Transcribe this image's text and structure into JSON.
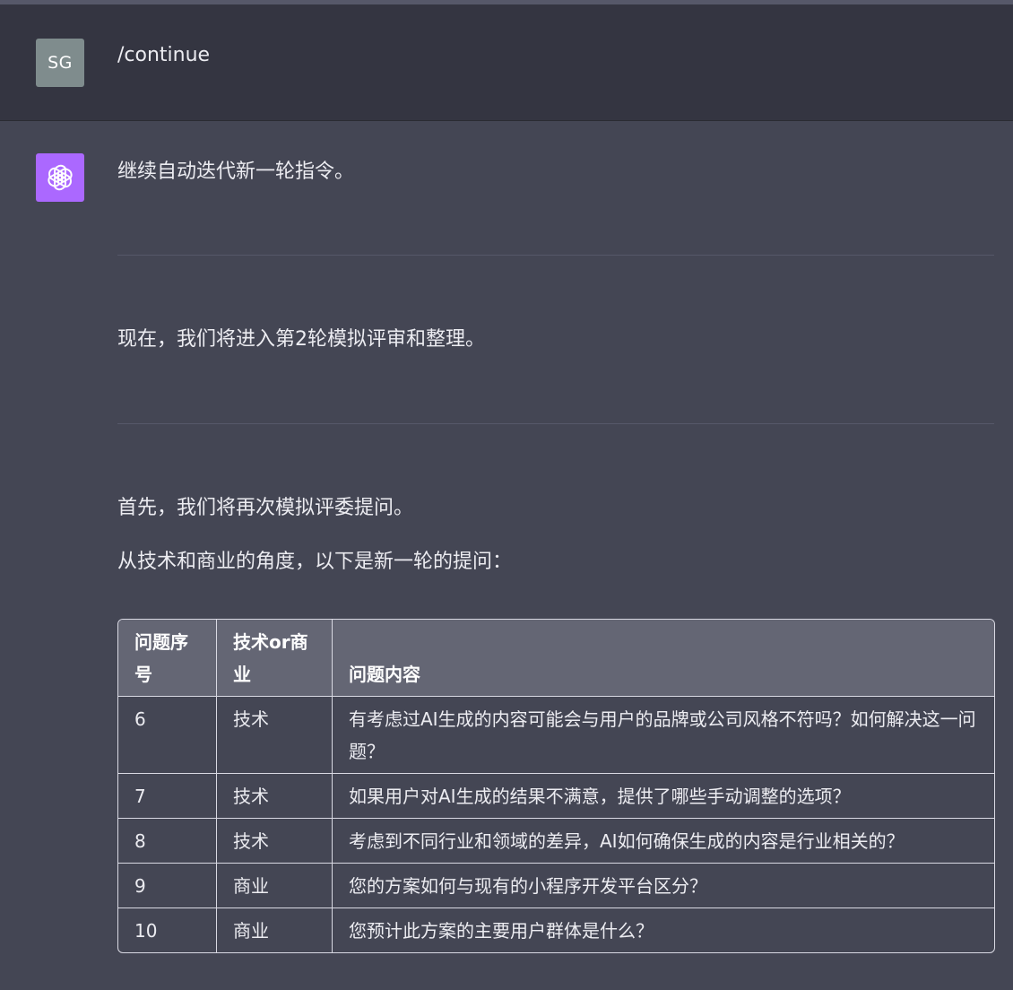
{
  "user_message": {
    "avatar_initials": "SG",
    "text": "/continue"
  },
  "assistant_message": {
    "paragraphs": [
      "继续自动迭代新一轮指令。",
      "现在，我们将进入第2轮模拟评审和整理。",
      "首先，我们将再次模拟评委提问。",
      "从技术和商业的角度，以下是新一轮的提问："
    ],
    "table": {
      "headers": [
        "问题序号",
        "技术or商业",
        "问题内容"
      ],
      "rows": [
        [
          "6",
          "技术",
          "有考虑过AI生成的内容可能会与用户的品牌或公司风格不符吗？如何解决这一问题？"
        ],
        [
          "7",
          "技术",
          "如果用户对AI生成的结果不满意，提供了哪些手动调整的选项？"
        ],
        [
          "8",
          "技术",
          "考虑到不同行业和领域的差异，AI如何确保生成的内容是行业相关的？"
        ],
        [
          "9",
          "商业",
          "您的方案如何与现有的小程序开发平台区分？"
        ],
        [
          "10",
          "商业",
          "您预计此方案的主要用户群体是什么？"
        ]
      ]
    }
  },
  "colors": {
    "user_bg": "#343541",
    "assistant_bg": "#444654",
    "bot_avatar": "#ab68ff",
    "user_avatar": "#7f8c8d"
  }
}
